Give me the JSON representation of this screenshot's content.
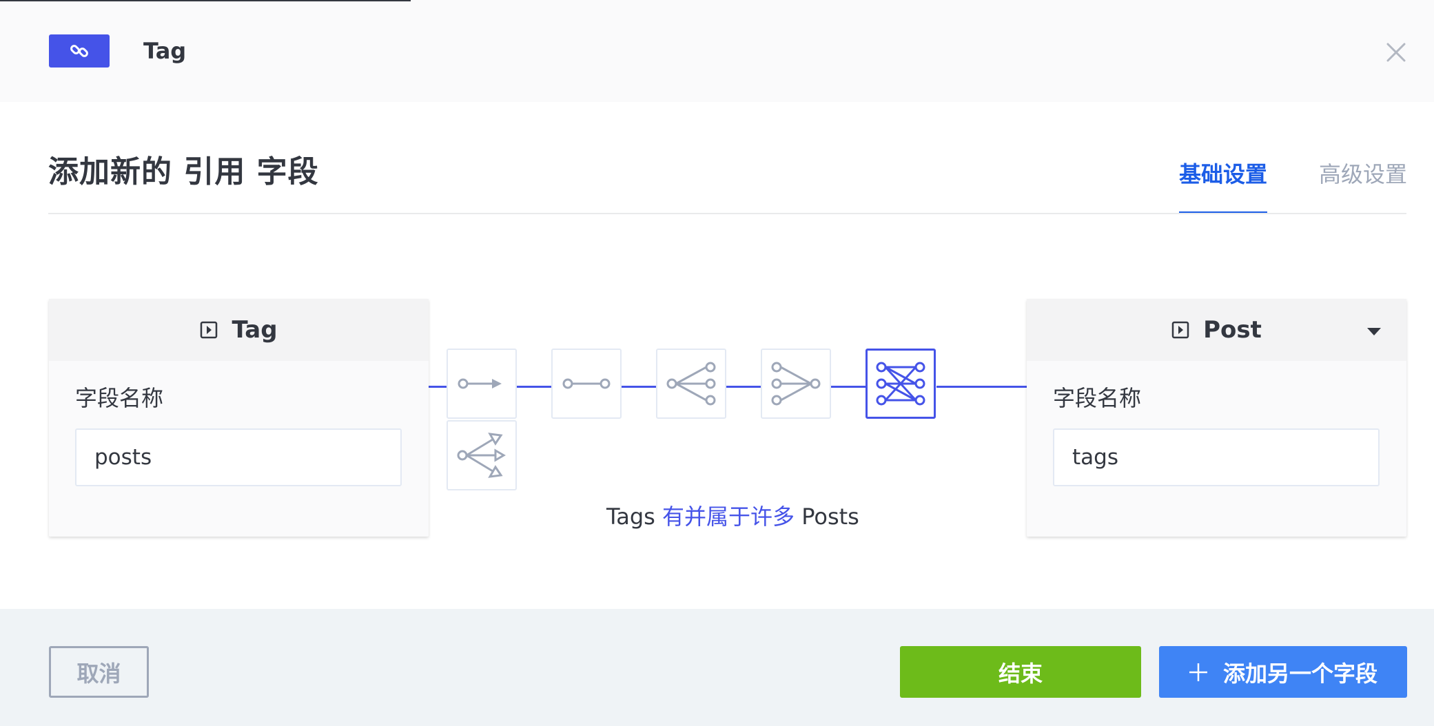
{
  "header": {
    "title": "Tag",
    "badge_icon": "link-icon",
    "close_icon": "close-icon"
  },
  "modal": {
    "title": "添加新的 引用 字段"
  },
  "tabs": [
    {
      "label": "基础设置",
      "active": true
    },
    {
      "label": "高级设置",
      "active": false
    }
  ],
  "left_card": {
    "title": "Tag",
    "icon": "content-type-icon",
    "field_label": "字段名称",
    "field_value": "posts"
  },
  "right_card": {
    "title": "Post",
    "icon": "content-type-icon",
    "dropdown_icon": "caret-down-icon",
    "field_label": "字段名称",
    "field_value": "tags"
  },
  "relation_options": [
    {
      "name": "one-way",
      "icon": "one-way-relation-icon",
      "active": false
    },
    {
      "name": "one-to-one",
      "icon": "one-to-one-relation-icon",
      "active": false
    },
    {
      "name": "one-to-many",
      "icon": "one-to-many-relation-icon",
      "active": false
    },
    {
      "name": "many-to-one",
      "icon": "many-to-one-relation-icon",
      "active": false
    },
    {
      "name": "many-to-many",
      "icon": "many-to-many-relation-icon",
      "active": true
    },
    {
      "name": "many-way",
      "icon": "many-way-relation-icon",
      "active": false
    }
  ],
  "relation_text": {
    "left": "Tags",
    "middle": "有并属于许多",
    "right": "Posts"
  },
  "footer": {
    "cancel_label": "取消",
    "finish_label": "结束",
    "add_label": "添加另一个字段",
    "add_icon": "plus-icon"
  },
  "colors": {
    "primary": "#4553e8",
    "tab_active": "#1c5de7",
    "finish_green": "#6dbb1a",
    "add_blue": "#3f84f5",
    "muted": "#9ea7b8"
  }
}
